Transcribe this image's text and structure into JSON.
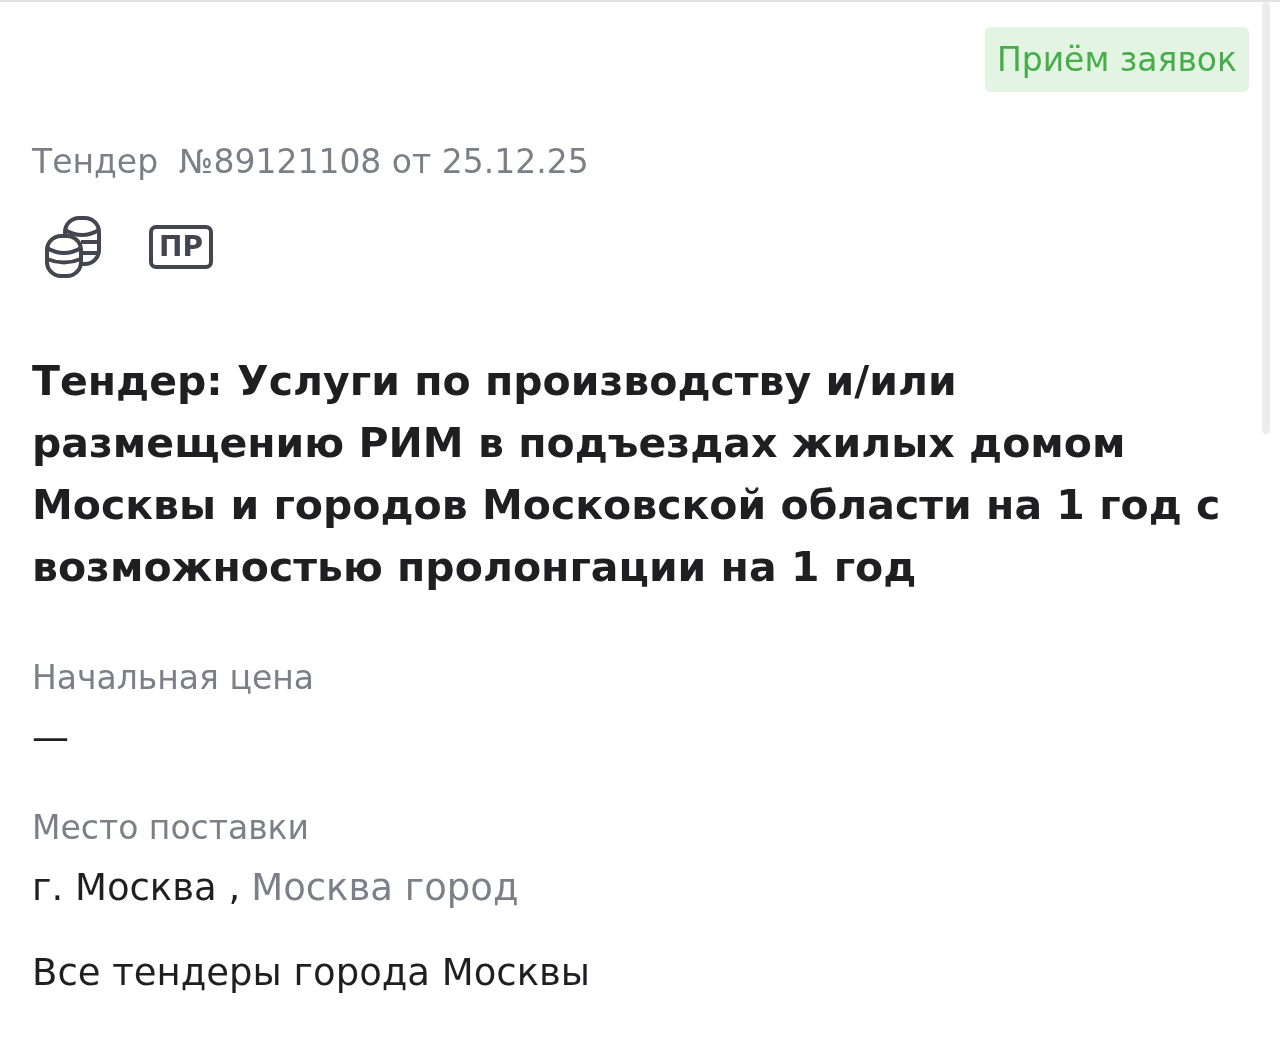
{
  "status_badge": "Приём заявок",
  "tender_meta": "Тендер  №89121108 от 25.12.25",
  "feature_icons": [
    {
      "kind": "coins"
    },
    {
      "kind": "label",
      "text": "ПР"
    }
  ],
  "title": "Тендер: Услуги по производству и/или размещению РИМ в подъездах жилых домом Москвы и городов Московской области на 1 год с возможностью пролонгации на 1 год",
  "fields": [
    {
      "label": "Начальная цена",
      "value": "—"
    },
    {
      "label": "Место поставки",
      "value": "г. Москва ,",
      "link": "Москва город"
    }
  ],
  "all_tenders_link": "Все тендеры города Москвы"
}
